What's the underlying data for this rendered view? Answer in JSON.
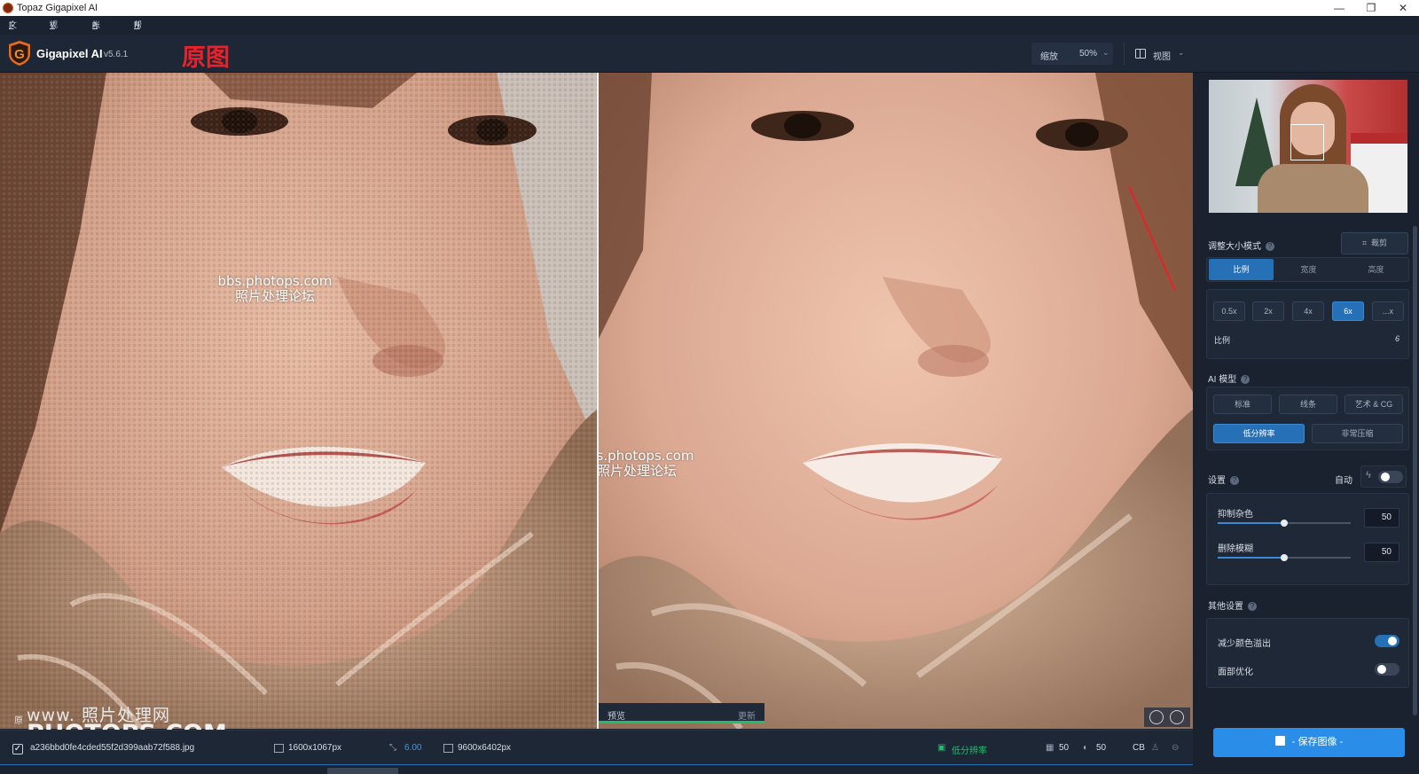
{
  "window": {
    "title": "Topaz Gigapixel AI",
    "min": "—",
    "max": "❐",
    "close": "✕"
  },
  "menu": [
    {
      "label": "文件",
      "key": "F"
    },
    {
      "label": "视图",
      "key": "V"
    },
    {
      "label": "帐户",
      "key": "A"
    },
    {
      "label": "帮助",
      "key": "H"
    }
  ],
  "header": {
    "brand": "Gigapixel AI",
    "version": "v5.6.1",
    "overlay_label": "原图",
    "zoom_label": "缩放",
    "zoom_value": "50%",
    "view_label": "视图"
  },
  "watermarks": {
    "site": "bbs.photops.com",
    "forum": "照片处理论坛",
    "corner_cn": "www.    照片处理网",
    "corner_en": "PHOTOPS.COM",
    "original_small": "原"
  },
  "preview": {
    "label": "预览",
    "update": "更新",
    "progress": 1.0
  },
  "panel": {
    "resize_mode": {
      "title": "调整大小模式",
      "crop": "裁剪",
      "tabs": [
        "比例",
        "宽度",
        "高度"
      ],
      "active_tab": 0
    },
    "scale_buttons": [
      "0.5x",
      "2x",
      "4x",
      "6x",
      "...x"
    ],
    "active_scale": 3,
    "scale_label": "比例",
    "scale_value": "6",
    "ai_model": {
      "title": "AI 模型",
      "row1": [
        "标准",
        "线条",
        "艺术 & CG"
      ],
      "row2": [
        "低分辨率",
        "非常压缩"
      ],
      "active": "低分辨率"
    },
    "settings": {
      "title": "设置",
      "auto_label": "自动",
      "auto_on": false,
      "noise_label": "抑制杂色",
      "noise_value": "50",
      "blur_label": "删除模糊",
      "blur_value": "50"
    },
    "other": {
      "title": "其他设置",
      "color_bleed_label": "减少颜色溢出",
      "color_bleed_on": true,
      "face_label": "面部优化",
      "face_on": false
    },
    "save_label": "- 保存图像 -"
  },
  "filebar": {
    "checked": "✓",
    "filename": "a236bbd0fe4cded55f2d399aab72f588.jpg",
    "input_size": "1600x1067px",
    "scale": "6.00",
    "output_size": "9600x6402px",
    "model": "低分辨率",
    "noise": "50",
    "blur": "50",
    "cb": "CB"
  },
  "colors": {
    "accent": "#2670b8",
    "save": "#2a8ee8",
    "red_label": "#e8222a",
    "progress": "#1fbf6a"
  }
}
